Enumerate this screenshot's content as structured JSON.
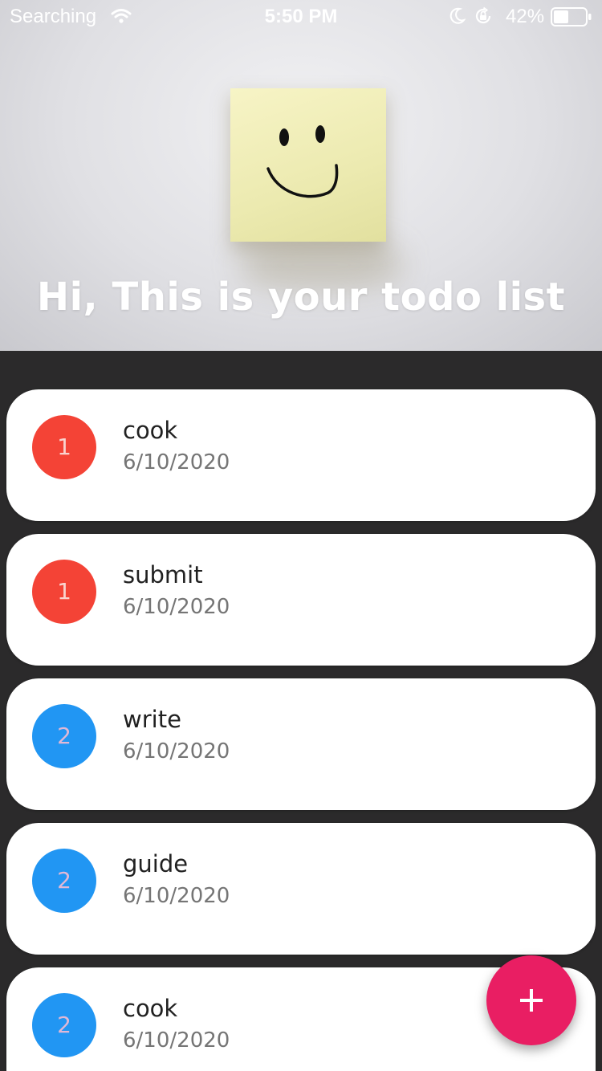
{
  "status_bar": {
    "carrier": "Searching",
    "time": "5:50 PM",
    "battery": "42%",
    "icons": [
      "wifi-icon",
      "moon-icon",
      "lock-rotation-icon",
      "battery-icon"
    ]
  },
  "header": {
    "title": "Hi, This is your todo list",
    "image": "sticky-note-smiley"
  },
  "tasks": [
    {
      "title": "cook",
      "date": "6/10/2020",
      "priority": "1"
    },
    {
      "title": "submit",
      "date": "6/10/2020",
      "priority": "1"
    },
    {
      "title": "write",
      "date": "6/10/2020",
      "priority": "2"
    },
    {
      "title": "guide",
      "date": "6/10/2020",
      "priority": "2"
    },
    {
      "title": "cook",
      "date": "6/10/2020",
      "priority": "2"
    }
  ],
  "fab": {
    "icon": "plus-icon"
  },
  "colors": {
    "priority_1": "#f44336",
    "priority_2": "#2196f3",
    "fab": "#e91e63",
    "background": "#2b2a2b"
  }
}
